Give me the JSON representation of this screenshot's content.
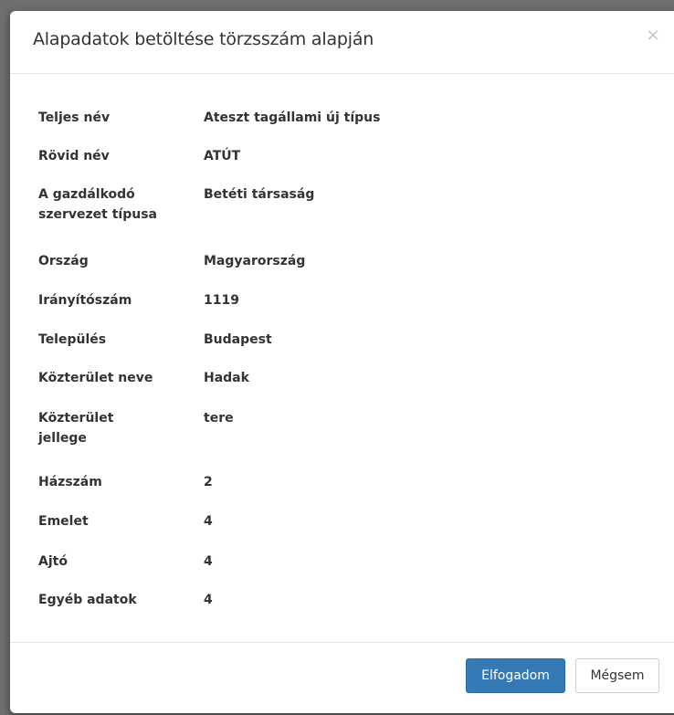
{
  "dialog": {
    "title": "Alapadatok betöltése törzsszám alapján",
    "close_label": "×"
  },
  "details": [
    {
      "label": "Teljes név",
      "value": "Ateszt tagállami új típus"
    },
    {
      "label": "Rövid név",
      "value": "ATÚT"
    },
    {
      "label": "A gazdálkodó szervezet típusa",
      "value": "Betéti társaság"
    },
    {
      "label": "Ország",
      "value": "Magyarország"
    },
    {
      "label": "Irányítószám",
      "value": "1119"
    },
    {
      "label": "Település",
      "value": "Budapest"
    },
    {
      "label": "Közterület neve",
      "value": "Hadak"
    },
    {
      "label": "Közterület jellege",
      "value": "tere"
    },
    {
      "label": "Házszám",
      "value": "2"
    },
    {
      "label": "Emelet",
      "value": "4"
    },
    {
      "label": "Ajtó",
      "value": "4"
    },
    {
      "label": "Egyéb adatok",
      "value": "4"
    }
  ],
  "footer": {
    "accept_label": "Elfogadom",
    "cancel_label": "Mégsem"
  },
  "colors": {
    "primary": "#337ab7",
    "overlay": "#6f6f6f"
  }
}
